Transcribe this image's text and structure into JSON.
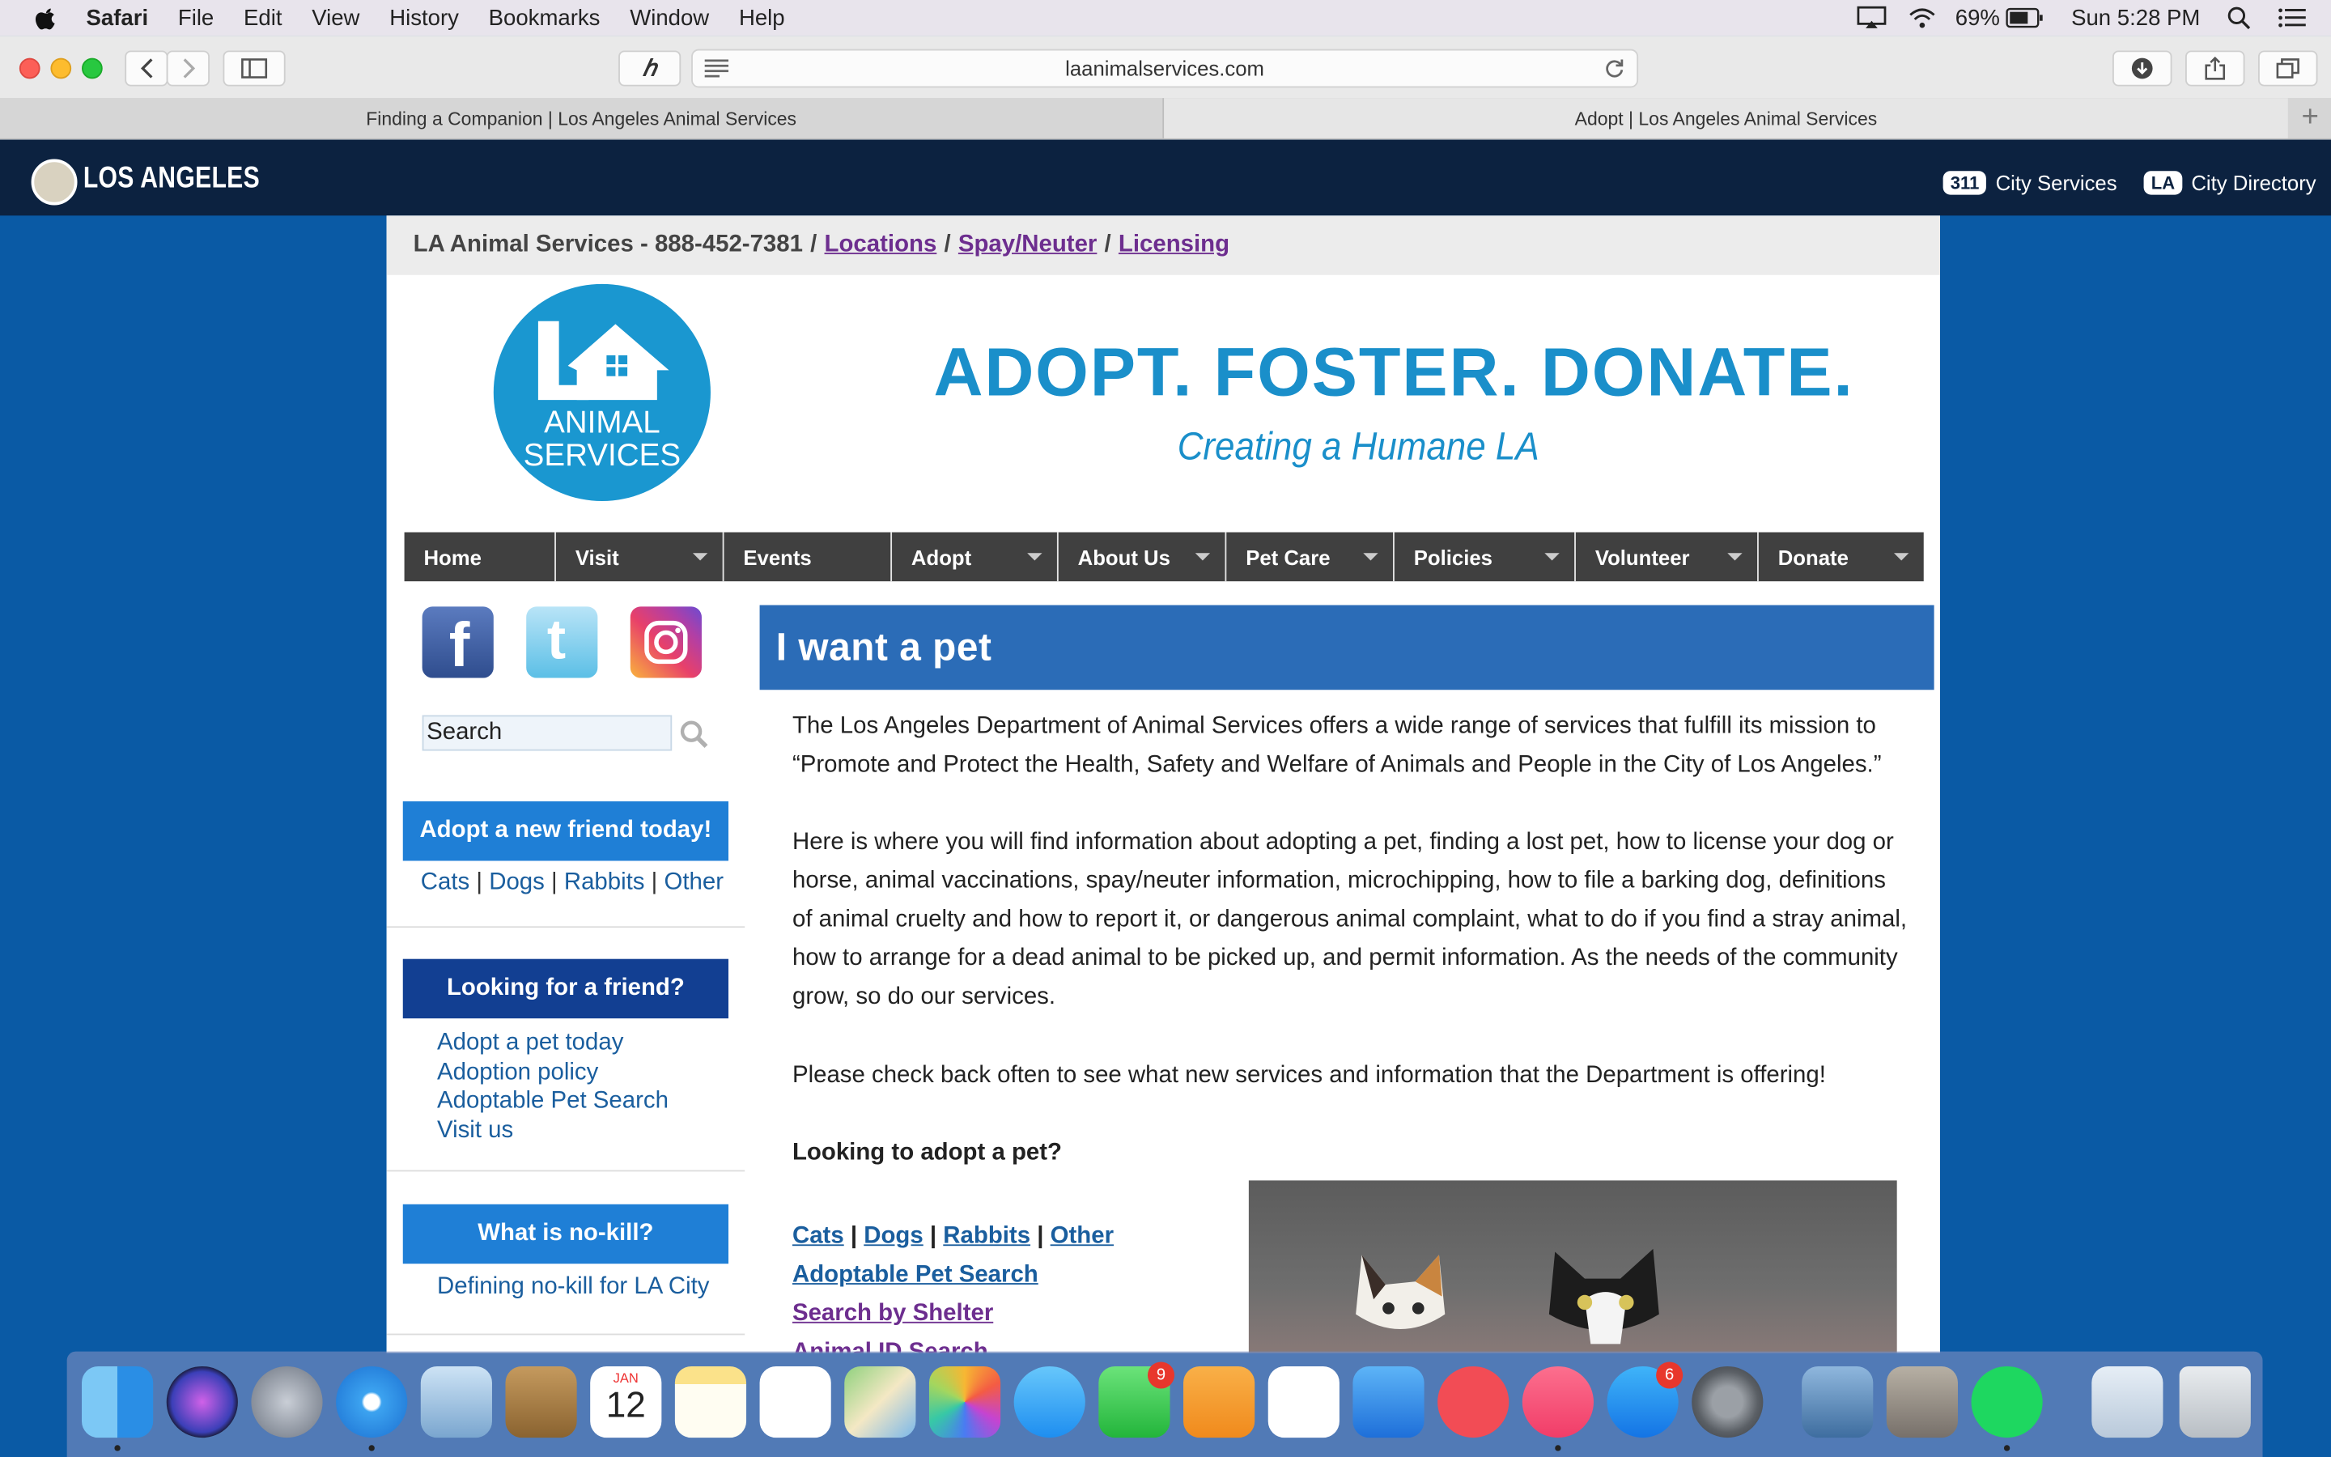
{
  "menubar": {
    "app": "Safari",
    "items": [
      "File",
      "Edit",
      "View",
      "History",
      "Bookmarks",
      "Window",
      "Help"
    ],
    "battery": "69%",
    "clock": "Sun 5:28 PM"
  },
  "browser": {
    "url": "laanimalservices.com",
    "tabs": [
      {
        "title": "Finding a Companion | Los Angeles Animal Services",
        "active": false
      },
      {
        "title": "Adopt | Los Angeles Animal Services",
        "active": true
      }
    ],
    "new_tab": "+"
  },
  "city_header": {
    "title": "LOS ANGELES",
    "services_badge": "311",
    "services_label": "City Services",
    "directory_badge": "LA",
    "directory_label": "City Directory"
  },
  "topstrip": {
    "text": "LA Animal Services - 888-452-7381",
    "sep": "/",
    "links": [
      "Locations",
      "Spay/Neuter",
      "Licensing"
    ]
  },
  "logo": {
    "line1": "ANIMAL",
    "line2": "SERVICES"
  },
  "banner": {
    "headline": "ADOPT. FOSTER. DONATE.",
    "tagline": "Creating a Humane LA"
  },
  "nav": [
    {
      "label": "Home",
      "dropdown": false
    },
    {
      "label": "Visit",
      "dropdown": true
    },
    {
      "label": "Events",
      "dropdown": false
    },
    {
      "label": "Adopt",
      "dropdown": true
    },
    {
      "label": "About Us",
      "dropdown": true
    },
    {
      "label": "Pet Care",
      "dropdown": true
    },
    {
      "label": "Policies",
      "dropdown": true
    },
    {
      "label": "Volunteer",
      "dropdown": true
    },
    {
      "label": "Donate",
      "dropdown": true
    }
  ],
  "sidebar": {
    "search_placeholder": "Search",
    "box1": {
      "title": "Adopt a new friend today!",
      "links": [
        "Cats",
        "Dogs",
        "Rabbits",
        "Other"
      ]
    },
    "box2": {
      "title": "Looking for a friend?",
      "links": [
        "Adopt a pet today",
        "Adoption policy",
        "Adoptable Pet Search",
        "Visit us"
      ]
    },
    "box3": {
      "title": "What is no-kill?",
      "links": [
        "Defining no-kill for LA City"
      ]
    }
  },
  "main": {
    "title": "I want a pet",
    "p1": "The Los Angeles Department of Animal Services offers a wide range of services that fulfill its mission to “Promote and Protect the Health, Safety and Welfare of Animals and People in the City of Los Angeles.”",
    "p2": "Here is where you will find information about adopting a pet, finding a lost pet, how to license your dog or horse, animal vaccinations, spay/neuter information, microchipping, how to file a barking dog, definitions of animal cruelty and how to report it, or dangerous animal complaint, what to do if you find a stray animal, how to arrange for a dead animal to be picked up, and permit information. As the needs of the community grow, so do our services.",
    "p3": "Please check back often to see what new services and information that the Department is offering!",
    "adopt_heading": "Looking to adopt a pet?",
    "adopt_links": [
      "Cats",
      "Dogs",
      "Rabbits",
      "Other"
    ],
    "link_pet_search": "Adoptable Pet Search",
    "link_shelter": "Search by Shelter",
    "link_id": "Animal ID Search"
  },
  "dock": {
    "calendar_month": "JAN",
    "calendar_day": "12",
    "facetime_badge": "9",
    "appstore_badge": "6"
  },
  "colors": {
    "page_bg": "#0a5aa5",
    "city_header": "#0c2240",
    "title_bar": "#2b6cb7",
    "banner_blue": "#1a8fca",
    "link_purple": "#6d2e8f"
  }
}
